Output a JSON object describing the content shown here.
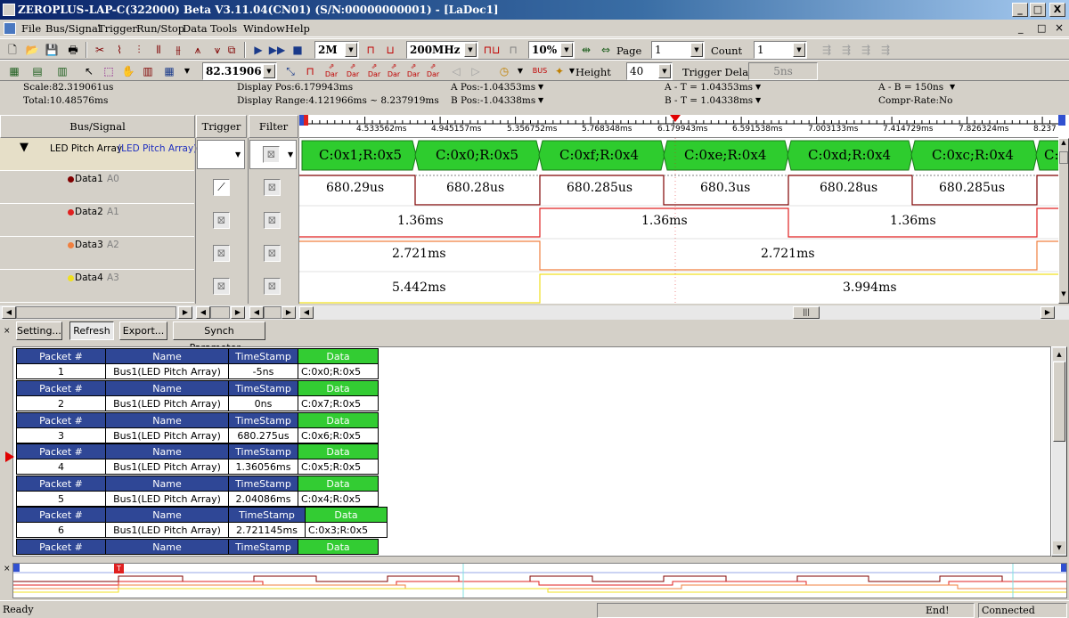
{
  "window": {
    "title": "ZEROPLUS-LAP-C(322000) Beta V3.11.04(CN01) (S/N:00000000001) - [LaDoc1]",
    "controls": [
      "_",
      "□",
      "X"
    ],
    "inner_controls": [
      "_",
      "□",
      "×"
    ]
  },
  "menu": [
    "File",
    "Bus/Signal",
    "Trigger",
    "Run/Stop",
    "Data",
    "Tools",
    "Window",
    "Help"
  ],
  "toolbar1": {
    "memory": "2M",
    "frequency": "200MHz",
    "zoom": "10%",
    "page_label": "Page",
    "page_value": "1",
    "count_label": "Count",
    "count_value": "1"
  },
  "toolbar2": {
    "scale_value": "82.319061",
    "height_label": "Height",
    "height_value": "40",
    "trigger_delay_label": "Trigger Delay",
    "trigger_delay_value": "5ns",
    "dar_labels": [
      "Dar",
      "Dar",
      "Dar",
      "Dar",
      "Dar",
      "Dar"
    ]
  },
  "info": {
    "scale": "Scale:82.319061us",
    "total": "Total:10.48576ms",
    "display_pos": "Display Pos:6.179943ms",
    "display_range": "Display Range:4.121966ms ~ 8.237919ms",
    "a_pos": "A Pos:-1.04353ms",
    "b_pos": "B Pos:-1.04338ms",
    "a_t": "A - T = 1.04353ms",
    "b_t": "B - T = 1.04338ms",
    "a_b": "A - B = 150ns",
    "compr_rate": "Compr-Rate:No"
  },
  "signal_panel": {
    "header_bus": "Bus/Signal",
    "header_trigger": "Trigger",
    "header_filter": "Filter",
    "bus": {
      "name": "LED Pitch Array",
      "alias": "(LED Pitch Array)"
    },
    "signals": [
      {
        "name": "Data1",
        "alias": "A0",
        "color": "#800000"
      },
      {
        "name": "Data2",
        "alias": "A1",
        "color": "#e02020"
      },
      {
        "name": "Data3",
        "alias": "A2",
        "color": "#f08040"
      },
      {
        "name": "Data4",
        "alias": "A3",
        "color": "#f0e020"
      }
    ]
  },
  "ruler": {
    "ticks": [
      "4.533562ms",
      "4.945157ms",
      "5.356752ms",
      "5.768348ms",
      "6.179943ms",
      "6.591538ms",
      "7.003133ms",
      "7.414729ms",
      "7.826324ms",
      "8.237"
    ]
  },
  "waveform": {
    "bus_segments": [
      "C:0x1;R:0x5",
      "C:0x0;R:0x5",
      "C:0xf;R:0x4",
      "C:0xe;R:0x4",
      "C:0xd;R:0x4",
      "C:0xc;R:0x4",
      "C:"
    ],
    "data1": [
      "680.29us",
      "680.28us",
      "680.285us",
      "680.3us",
      "680.28us",
      "680.285us"
    ],
    "data2": [
      "1.36ms",
      "1.36ms",
      "1.36ms"
    ],
    "data3": [
      "2.721ms",
      "2.721ms"
    ],
    "data4": [
      "5.442ms",
      "3.994ms"
    ]
  },
  "packet_toolbar": [
    "Setting...",
    "Refresh",
    "Export...",
    "Synch Parameter..."
  ],
  "packet_headers": {
    "packet": "Packet #",
    "name": "Name",
    "timestamp": "TimeStamp",
    "data": "Data"
  },
  "packets": [
    {
      "num": "1",
      "name": "Bus1(LED Pitch Array)",
      "ts": "-5ns",
      "data": "C:0x0;R:0x5"
    },
    {
      "num": "2",
      "name": "Bus1(LED Pitch Array)",
      "ts": "0ns",
      "data": "C:0x7;R:0x5"
    },
    {
      "num": "3",
      "name": "Bus1(LED Pitch Array)",
      "ts": "680.275us",
      "data": "C:0x6;R:0x5"
    },
    {
      "num": "4",
      "name": "Bus1(LED Pitch Array)",
      "ts": "1.36056ms",
      "data": "C:0x5;R:0x5"
    },
    {
      "num": "5",
      "name": "Bus1(LED Pitch Array)",
      "ts": "2.04086ms",
      "data": "C:0x4;R:0x5"
    },
    {
      "num": "6",
      "name": "Bus1(LED Pitch Array)",
      "ts": "2.721145ms",
      "data": "C:0x3;R:0x5"
    }
  ],
  "overview": {
    "trigger_mark": "T"
  },
  "status": {
    "left": "Ready",
    "end": "End!",
    "connection": "Connected"
  }
}
